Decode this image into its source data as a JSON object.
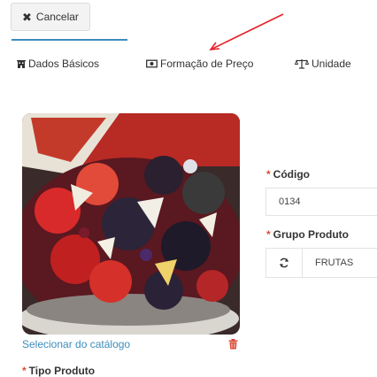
{
  "toolbar": {
    "cancel_label": "Cancelar",
    "cancel_icon": "times-icon"
  },
  "tabs": [
    {
      "label": "Dados Básicos",
      "icon": "building-icon",
      "active": true
    },
    {
      "label": "Formação de Preço",
      "icon": "money-icon",
      "active": false
    },
    {
      "label": "Unidade",
      "icon": "balance-scale-icon",
      "active": false
    }
  ],
  "image_panel": {
    "catalog_link": "Selecionar do catálogo",
    "delete_icon": "trash-icon"
  },
  "form": {
    "required_mark": "*",
    "tipo_label": "Tipo Produto",
    "codigo_label": "Código",
    "codigo_value": "0134",
    "grupo_label": "Grupo Produto",
    "grupo_value": "FRUTAS"
  },
  "colors": {
    "accent": "#3c8dbc",
    "required": "#dd4b39",
    "annotation": "#e8212a"
  }
}
